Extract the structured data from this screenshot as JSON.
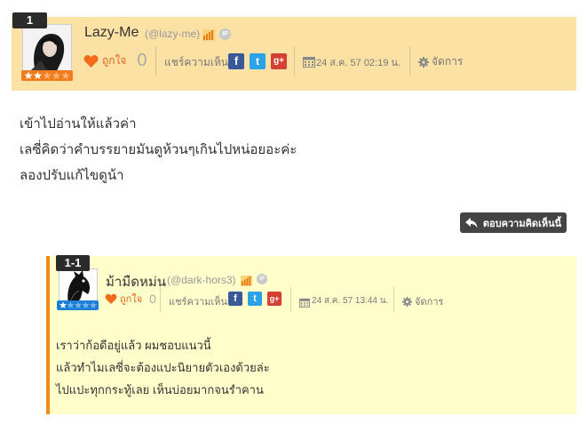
{
  "comment": {
    "number": "1",
    "username": "Lazy-Me",
    "handle": "(@lazy-me)",
    "like_label": "ถูกใจ",
    "like_count": "0",
    "share_label": "แชร์ความเห็น",
    "datetime": "24 ส.ค. 57 02:19 น.",
    "manage_label": "จัดการ",
    "body_lines": [
      "เข้าไปอ่านให้แล้วค่า",
      "เลซี่คิดว่าคำบรรยายมันดูห้วนๆเกินไปหน่อยอะค่ะ",
      "ลองปรับแก้ไขดูน้า"
    ],
    "rank_stars_filled": 2,
    "rank_stars_total": 5
  },
  "reply_button_label": "ตอบความคิดเห็นนี้",
  "ip_label": "IP",
  "social": {
    "facebook": "f",
    "twitter": "t",
    "googleplus": "g+"
  },
  "subcomment": {
    "number": "1-1",
    "username": "ม้ามืดหม่น",
    "handle": "(@dark-hors3)",
    "like_label": "ถูกใจ",
    "like_count": "0",
    "share_label": "แชร์ความเห็น",
    "datetime": "24 ส.ค. 57 13:44 น.",
    "manage_label": "จัดการ",
    "body_lines": [
      "เราว่าก้อดีอยู่แล้ว ผมชอบแนวนี้",
      "แล้วทำไมเลซี่จะต้องแปะนิยายตัวเองด้วยล่ะ",
      "ไปแปะทุกกระทู้เลย เห็นบ่อยมากจนรำคาน"
    ],
    "rank_stars_filled": 1,
    "rank_stars_total": 5
  },
  "colors": {
    "head_bg": "#fce1a4",
    "sub_bg": "#ffffcc",
    "accent_orange": "#f28a15",
    "rank_main": "#f07c1b",
    "rank_sub": "#1d7fd6"
  }
}
